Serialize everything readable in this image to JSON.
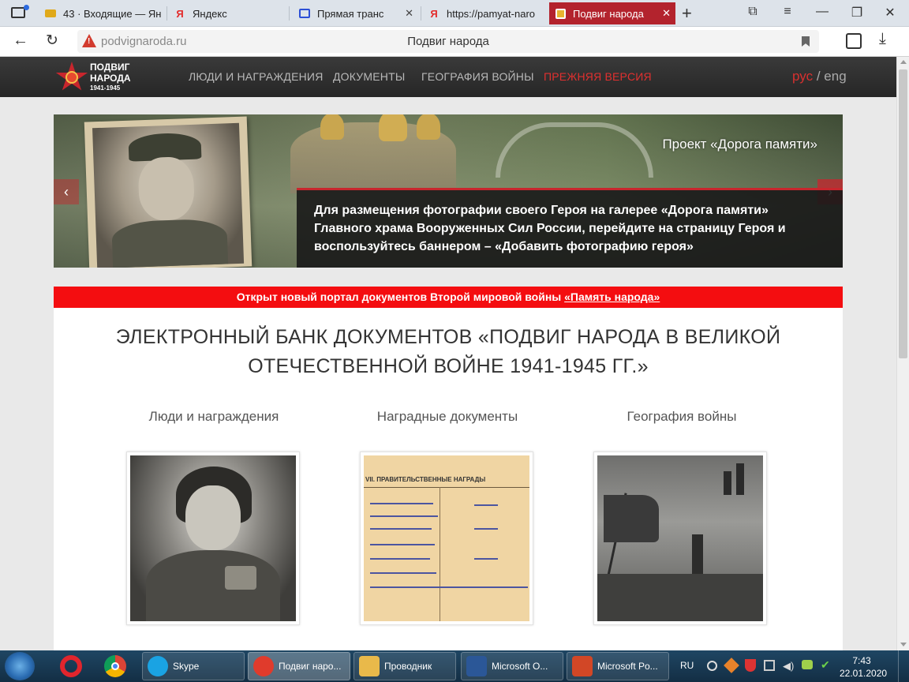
{
  "browser": {
    "tabs": [
      {
        "label": "43 · Входящие — Ян",
        "icon": "mail-icon",
        "color": "#e0a91a"
      },
      {
        "label": "Яндекс",
        "icon": "yandex-icon",
        "color": "#e32b2b"
      },
      {
        "label": "Прямая транс",
        "icon": "video-icon",
        "color": "#2d4fd6"
      },
      {
        "label": "https://pamyat-naro",
        "icon": "yandex-icon",
        "color": "#e32b2b"
      },
      {
        "label": "Подвиг народа",
        "icon": "order-icon",
        "color": "#c8262d"
      }
    ],
    "url": "podvignaroda.ru",
    "page_title": "Подвиг народа"
  },
  "site": {
    "logo": {
      "line1": "ПОДВИГ",
      "line2": "НАРОДА",
      "years": "1941-1945"
    },
    "nav": {
      "people": "ЛЮДИ И НАГРАЖДЕНИЯ",
      "documents": "ДОКУМЕНТЫ",
      "geography": "ГЕОГРАФИЯ ВОЙНЫ",
      "old_version": "ПРЕЖНЯЯ ВЕРСИЯ"
    },
    "lang": {
      "rus": "рус",
      "sep": "/",
      "eng": "eng"
    },
    "colors": {
      "accent": "#c8262d",
      "alert": "#f40d10"
    }
  },
  "banner": {
    "project": "Проект «Дорога памяти»",
    "text": "Для размещения фотографии своего Героя на галерее «Дорога памяти» Главного храма Вооруженных Сил России, перейдите на страницу Героя и воспользуйтесь баннером – «Добавить фотографию героя»"
  },
  "alert": {
    "text": "Открыт новый портал документов Второй мировой войны ",
    "link": "«Память народа»"
  },
  "main": {
    "title_line1": "ЭЛЕКТРОННЫЙ БАНК ДОКУМЕНТОВ «ПОДВИГ НАРОДА В ВЕЛИКОЙ",
    "title_line2": "ОТЕЧЕСТВЕННОЙ ВОЙНЕ 1941-1945 ГГ.»",
    "categories": [
      {
        "title": "Люди и награждения"
      },
      {
        "title": "Наградные документы",
        "doc_header": "VII. ПРАВИТЕЛЬСТВЕННЫЕ НАГРАДЫ"
      },
      {
        "title": "География войны"
      }
    ]
  },
  "taskbar": {
    "items": [
      {
        "label": "Skype",
        "color": "#1aa3e3"
      },
      {
        "label": "Подвиг наро...",
        "color": "#e03b2c"
      },
      {
        "label": "Проводник",
        "color": "#e9b94a"
      },
      {
        "label": "Microsoft O...",
        "color": "#2b5797"
      },
      {
        "label": "Microsoft Po...",
        "color": "#d24726"
      }
    ],
    "lang": "RU",
    "time": "7:43",
    "date": "22.01.2020"
  }
}
